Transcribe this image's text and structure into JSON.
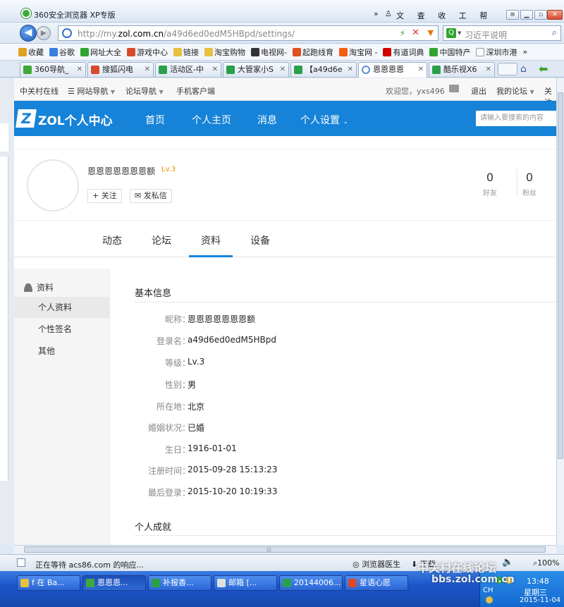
{
  "browser": {
    "title": "360安全浏览器 XP专版",
    "menus": [
      "文件",
      "查看",
      "收藏",
      "工具",
      "帮助"
    ],
    "url_prefix": "http://my.",
    "url_domain": "zol.com.cn",
    "url_suffix": "/a49d6ed0edM5HBpd/settings/",
    "search_placeholder": "习近平说明",
    "favorites": [
      {
        "label": "收藏",
        "color": "#e0a020"
      },
      {
        "label": "谷歌",
        "color": "#3a7ee0"
      },
      {
        "label": "网址大全",
        "color": "#2fa52f"
      },
      {
        "label": "游戏中心",
        "color": "#d84b2a"
      },
      {
        "label": "链接",
        "color": "#e8c040"
      },
      {
        "label": "淘宝购物",
        "color": "#e8c040"
      },
      {
        "label": "电视网-",
        "color": "#333333"
      },
      {
        "label": "起跑线育",
        "color": "#e05020"
      },
      {
        "label": "淘宝网 -",
        "color": "#f06010"
      },
      {
        "label": "有道词典",
        "color": "#d00000"
      },
      {
        "label": "中国特产",
        "color": "#2fa52f"
      },
      {
        "label": "深圳市港",
        "color": "#ffffff"
      }
    ],
    "tabs": [
      {
        "label": "360导航_",
        "color": "#3eaa3a"
      },
      {
        "label": "搜狐闪电",
        "color": "#d84b2a"
      },
      {
        "label": "活动区-中",
        "color": "#2aa04a"
      },
      {
        "label": "大管家小S",
        "color": "#2aa04a"
      },
      {
        "label": "【a49d6e",
        "color": "#2aa04a"
      },
      {
        "label": "恩恩恩恩",
        "color": "#5a8fd8"
      },
      {
        "label": "酷乐视X6",
        "color": "#2aa04a"
      }
    ],
    "status_text": "正在等待 acs86.com 的响应...",
    "status_doctor": "浏览器医生",
    "status_download": "下载",
    "zoom": "100%"
  },
  "site": {
    "topnav": {
      "left": [
        "中关村在线",
        "网站导航",
        "论坛导航",
        "手机客户端"
      ],
      "welcome": "欢迎您，yxs496",
      "logout": "退出",
      "myforum": "我的论坛",
      "more": "关注"
    },
    "header": {
      "logo": "Z",
      "brand": "ZOL个人中心",
      "nav": [
        "首页",
        "个人主页",
        "消息",
        "个人设置"
      ],
      "search_placeholder": "请输入要搜索的内容"
    },
    "profile": {
      "name": "恩恩恩恩恩恩恩额",
      "level": "Lv.3",
      "follow_label": "关注",
      "message_label": "发私信",
      "friends_count": "0",
      "friends_label": "好友",
      "fans_count": "0",
      "fans_label": "粉丝"
    },
    "tabs": [
      "动态",
      "论坛",
      "资料",
      "设备"
    ],
    "leftnav": {
      "header": "资料",
      "items": [
        "个人资料",
        "个性签名",
        "其他"
      ]
    },
    "info": {
      "title": "基本信息",
      "rows": [
        {
          "k": "昵称：",
          "v": "恩恩恩恩恩恩恩额"
        },
        {
          "k": "登录名：",
          "v": "a49d6ed0edM5HBpd"
        },
        {
          "k": "等级：",
          "v": "Lv.3"
        },
        {
          "k": "性别：",
          "v": "男"
        },
        {
          "k": "所在地：",
          "v": "北京"
        },
        {
          "k": "婚姻状况：",
          "v": "已婚"
        },
        {
          "k": "生日：",
          "v": "1916-01-01"
        },
        {
          "k": "注册时间：",
          "v": "2015-09-28 15:13:23"
        },
        {
          "k": "最后登录：",
          "v": "2015-10-20 10:19:33"
        }
      ],
      "section2": "个人成就"
    }
  },
  "taskbar": {
    "items": [
      {
        "label": "f 在 Ba...",
        "color": "#e8c040"
      },
      {
        "label": "恩恩恩...",
        "color": "#3eaa3a"
      },
      {
        "label": "补报香...",
        "color": "#2aa04a"
      },
      {
        "label": "邮箱 [...",
        "color": "#e0e0e0"
      },
      {
        "label": "20144006...",
        "color": "#2aa04a"
      },
      {
        "label": "星语心愿",
        "color": "#d84b2a"
      }
    ],
    "lang": "CH",
    "time": "13:48",
    "day": "星期三",
    "date": "2015-11-04"
  },
  "watermark": {
    "line1": "中关村在线论坛",
    "line2": "bbs.zol.com.cn"
  }
}
